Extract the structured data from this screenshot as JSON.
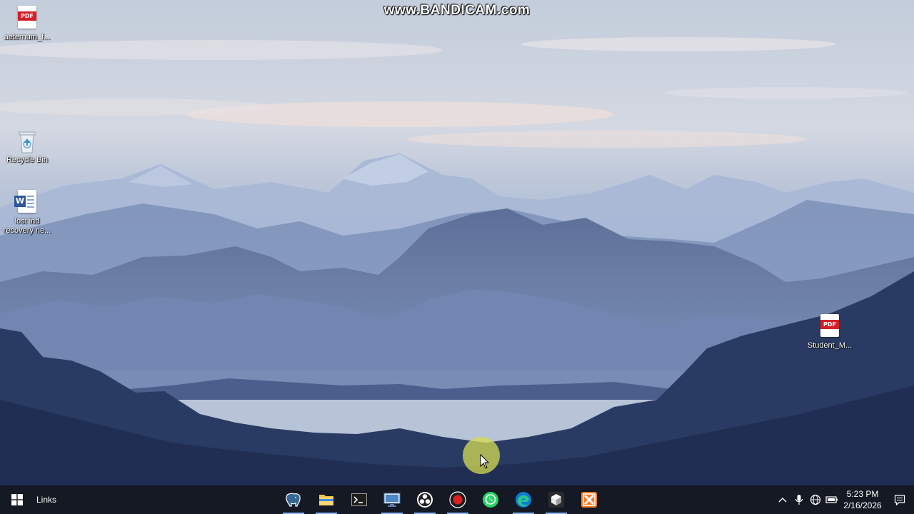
{
  "watermark": "www.BANDICAM.com",
  "desktop_icons": [
    {
      "label": "aeternum_f...",
      "type": "pdf",
      "badge": "PDF"
    },
    {
      "label": "Recycle Bin",
      "type": "recycle-bin"
    },
    {
      "label": "lost ind recovery ne...",
      "type": "word",
      "badge": "W"
    },
    {
      "label": "Student_M...",
      "type": "pdf",
      "badge": "PDF"
    }
  ],
  "taskbar": {
    "start_icon": "windows-logo-icon",
    "toolbar_label": "Links",
    "apps": [
      {
        "name": "pgadmin",
        "icon": "elephant-icon"
      },
      {
        "name": "file-explorer",
        "icon": "folder-icon"
      },
      {
        "name": "terminal",
        "icon": "terminal-icon"
      },
      {
        "name": "remote-desktop",
        "icon": "remote-desktop-icon"
      },
      {
        "name": "obs",
        "icon": "obs-icon"
      },
      {
        "name": "bandicam",
        "icon": "record-icon"
      },
      {
        "name": "whatsapp",
        "icon": "whatsapp-icon"
      },
      {
        "name": "edge",
        "icon": "edge-icon"
      },
      {
        "name": "unity",
        "icon": "unity-icon"
      },
      {
        "name": "xampp",
        "icon": "xampp-icon"
      }
    ],
    "clock": {
      "time": "5:23 PM",
      "date": "2/16/2026"
    }
  },
  "colors": {
    "pdf_red": "#d32027",
    "word_blue": "#2b579a",
    "taskbar_bg": "#14181f",
    "cursor_highlight": "#d6dc50"
  }
}
